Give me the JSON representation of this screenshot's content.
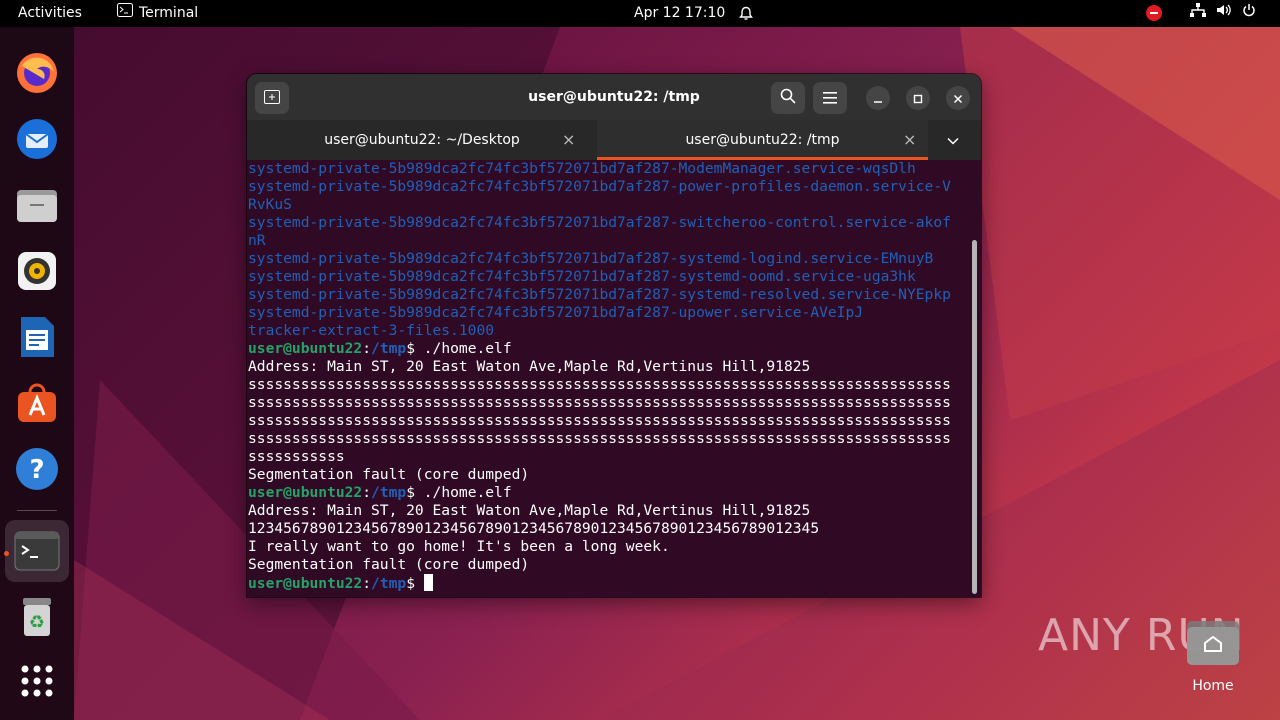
{
  "topbar": {
    "activities": "Activities",
    "app_name": "Terminal",
    "clock": "Apr 12  17:10"
  },
  "dock": {
    "apps": [
      "firefox-icon",
      "thunderbird-icon",
      "files-icon",
      "rhythmbox-icon",
      "libreoffice-writer-icon",
      "app-center-icon",
      "help-icon",
      "terminal-icon",
      "trash-icon",
      "show-apps-icon"
    ]
  },
  "window": {
    "title": "user@ubuntu22: /tmp",
    "tabs": [
      {
        "label": "user@ubuntu22: ~/Desktop",
        "close": "×"
      },
      {
        "label": "user@ubuntu22: /tmp",
        "close": "×"
      }
    ]
  },
  "terminal": {
    "listing": [
      "systemd-private-5b989dca2fc74fc3bf572071bd7af287-ModemManager.service-wqsDlh",
      "systemd-private-5b989dca2fc74fc3bf572071bd7af287-power-profiles-daemon.service-V",
      "RvKuS",
      "systemd-private-5b989dca2fc74fc3bf572071bd7af287-switcheroo-control.service-akof",
      "nR",
      "systemd-private-5b989dca2fc74fc3bf572071bd7af287-systemd-logind.service-EMnuyB",
      "systemd-private-5b989dca2fc74fc3bf572071bd7af287-systemd-oomd.service-uga3hk",
      "systemd-private-5b989dca2fc74fc3bf572071bd7af287-systemd-resolved.service-NYEpkp",
      "systemd-private-5b989dca2fc74fc3bf572071bd7af287-upower.service-AVeIpJ",
      "tracker-extract-3-files.1000"
    ],
    "prompt_user": "user@ubuntu22",
    "prompt_sep": ":",
    "prompt_path": "/tmp",
    "prompt_end": "$ ",
    "cmd1": "./home.elf",
    "run1": [
      "Address: Main ST, 20 East Waton Ave,Maple Rd,Vertinus Hill,91825",
      "ssssssssssssssssssssssssssssssssssssssssssssssssssssssssssssssssssssssssssssssss",
      "ssssssssssssssssssssssssssssssssssssssssssssssssssssssssssssssssssssssssssssssss",
      "ssssssssssssssssssssssssssssssssssssssssssssssssssssssssssssssssssssssssssssssss",
      "ssssssssssssssssssssssssssssssssssssssssssssssssssssssssssssssssssssssssssssssss",
      "sssssssssss",
      "Segmentation fault (core dumped)"
    ],
    "cmd2": "./home.elf",
    "run2": [
      "Address: Main ST, 20 East Waton Ave,Maple Rd,Vertinus Hill,91825",
      "12345678901234567890123456789012345678901234567890123456789012345",
      "I really want to go home! It's been a long week.",
      "Segmentation fault (core dumped)"
    ]
  },
  "watermark": "ANY  RUN",
  "desktop": {
    "home_label": "Home"
  }
}
